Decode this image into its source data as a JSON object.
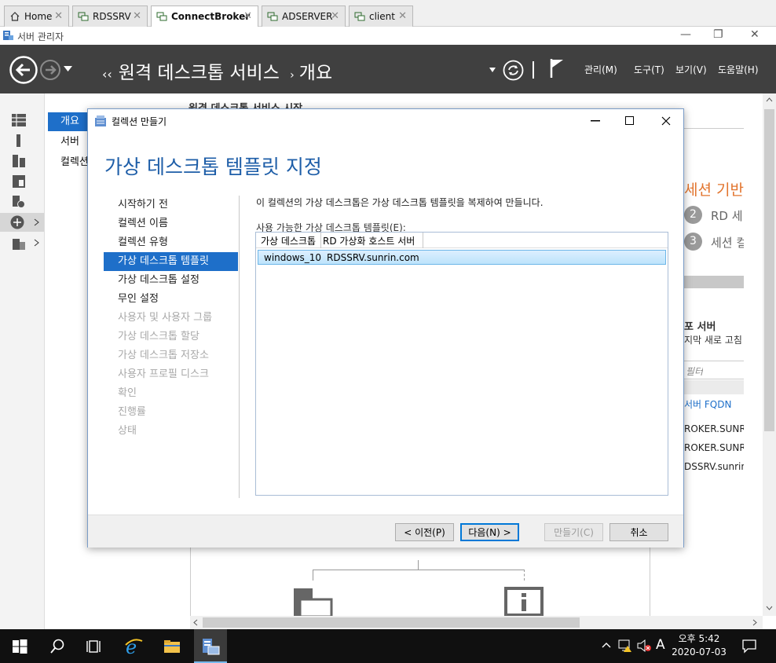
{
  "tabs": [
    {
      "label": "Home",
      "icon": "home-icon",
      "active": false
    },
    {
      "label": "RDSSRV",
      "icon": "remote-desktop-icon",
      "active": false
    },
    {
      "label": "ConnectBroker",
      "icon": "remote-desktop-icon",
      "active": true
    },
    {
      "label": "ADSERVER",
      "icon": "remote-desktop-icon",
      "active": false
    },
    {
      "label": "client",
      "icon": "remote-desktop-icon",
      "active": false
    }
  ],
  "tab_close": "✕",
  "window": {
    "title": "서버 관리자",
    "minimize": "—",
    "restore": "❐",
    "close": "✕"
  },
  "header": {
    "breadcrumb_arrows": "‹‹",
    "breadcrumb_root": "원격 데스크톱 서비스",
    "breadcrumb_sep": "›",
    "breadcrumb_page": "개요",
    "menu": [
      "관리(M)",
      "도구(T)",
      "보기(V)",
      "도움말(H)"
    ]
  },
  "subnav": [
    "개요",
    "서버",
    "컬렉션"
  ],
  "background": {
    "top_heading": "원격 데스크톱 서비스 시작",
    "session_title": "세션 기반",
    "step2_num": "2",
    "step2_text": "RD 세",
    "step3_num": "3",
    "step3_text": "세션 컬",
    "deploy_title": "포 서버",
    "deploy_sub": "지막 새로 고침",
    "filter_placeholder": "필터",
    "col_fqdn": "서버 FQDN",
    "servers": [
      "ROKER.SUNRI",
      "ROKER.SUNRI",
      "DSSRV.sunrin."
    ]
  },
  "dialog": {
    "title": "컬렉션 만들기",
    "heading": "가상 데스크톱 템플릿 지정",
    "steps": [
      {
        "label": "시작하기 전",
        "state": "done"
      },
      {
        "label": "컬렉션 이름",
        "state": "done"
      },
      {
        "label": "컬렉션 유형",
        "state": "done"
      },
      {
        "label": "가상 데스크톱 템플릿",
        "state": "current"
      },
      {
        "label": "가상 데스크톱 설정",
        "state": "done"
      },
      {
        "label": "무인 설정",
        "state": "done"
      },
      {
        "label": "사용자 및 사용자 그룹",
        "state": "disabled"
      },
      {
        "label": "가상 데스크톱 할당",
        "state": "disabled"
      },
      {
        "label": "가상 데스크톱 저장소",
        "state": "disabled"
      },
      {
        "label": "사용자 프로필 디스크",
        "state": "disabled"
      },
      {
        "label": "확인",
        "state": "disabled"
      },
      {
        "label": "진행률",
        "state": "disabled"
      },
      {
        "label": "상태",
        "state": "disabled"
      }
    ],
    "description": "이 컬렉션의 가상 데스크톱은 가상 데스크톱 템플릿을 복제하여 만들니다.",
    "list_label": "사용 가능한 가상 데스크톱 템플릿(E):",
    "columns": [
      "가상 데스크톱",
      "RD 가상화 호스트 서버"
    ],
    "rows": [
      {
        "template": "windows_10",
        "host": "RDSSRV.sunrin.com",
        "selected": true
      }
    ],
    "buttons": {
      "prev": "< 이전(P)",
      "next": "다음(N) >",
      "create": "만들기(C)",
      "cancel": "취소"
    }
  },
  "taskbar": {
    "time": "오후 5:42",
    "date": "2020-07-03",
    "ime": "A"
  }
}
